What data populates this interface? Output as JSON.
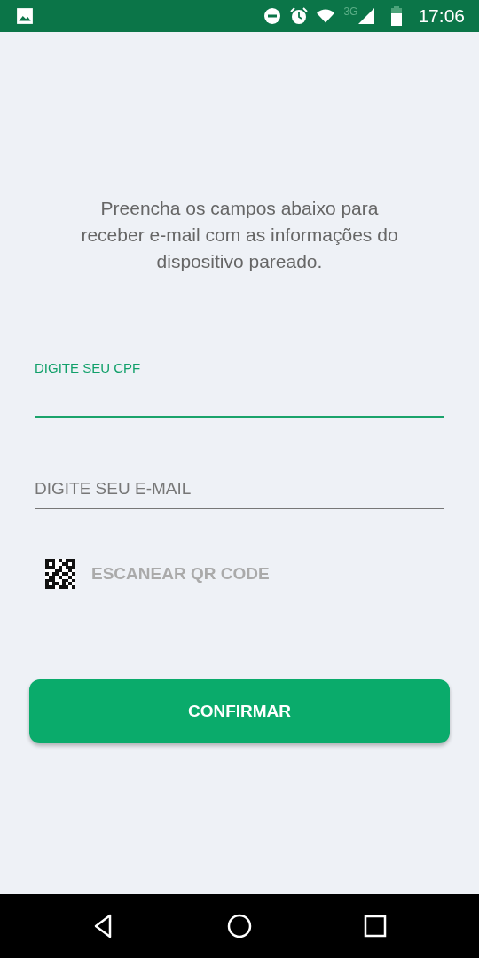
{
  "status_bar": {
    "network": "3G",
    "time": "17:06"
  },
  "instructions": "Preencha os campos abaixo para receber e-mail com as informações do dispositivo pareado.",
  "fields": [
    {
      "label": "DIGITE SEU CPF",
      "focused": true
    },
    {
      "placeholder": "DIGITE SEU E-MAIL",
      "focused": false
    }
  ],
  "scan_button": "ESCANEAR QR CODE",
  "confirm_button": "CONFIRMAR"
}
